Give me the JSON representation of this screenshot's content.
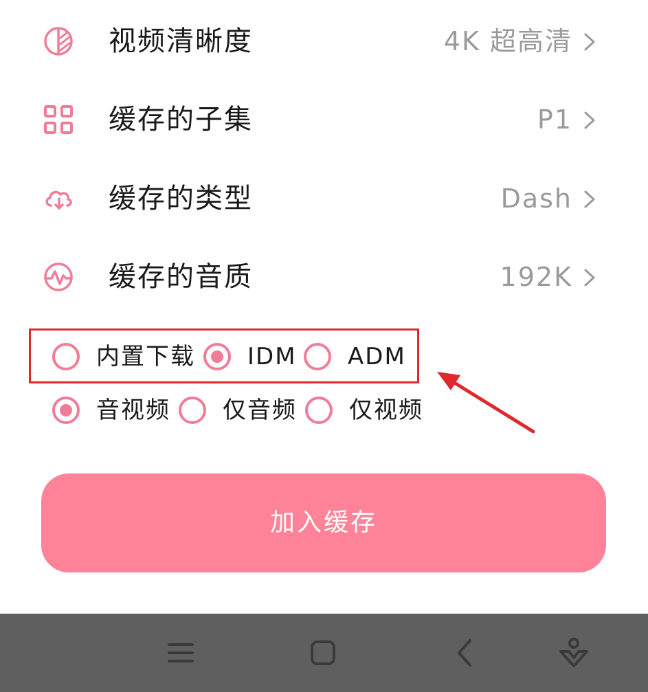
{
  "settings": [
    {
      "icon": "contrast-icon",
      "label": "视频清晰度",
      "value": "4K 超高清"
    },
    {
      "icon": "grid-icon",
      "label": "缓存的子集",
      "value": "P1"
    },
    {
      "icon": "cloud-download-icon",
      "label": "缓存的类型",
      "value": "Dash"
    },
    {
      "icon": "audio-wave-icon",
      "label": "缓存的音质",
      "value": "192K"
    }
  ],
  "downloader_options": {
    "selected": "IDM",
    "items": [
      {
        "label": "内置下载",
        "checked": false
      },
      {
        "label": "IDM",
        "checked": true
      },
      {
        "label": "ADM",
        "checked": false
      }
    ]
  },
  "media_options": {
    "selected": "音视频",
    "items": [
      {
        "label": "音视频",
        "checked": true
      },
      {
        "label": "仅音频",
        "checked": false
      },
      {
        "label": "仅视频",
        "checked": false
      }
    ]
  },
  "button": {
    "label": "加入缓存"
  },
  "colors": {
    "accent": "#f07d97",
    "button": "#fe8298",
    "annotation": "#e0292d",
    "nav_bar": "#5f5f5f"
  },
  "nav_icons": [
    "menu-icon",
    "home-icon",
    "back-icon",
    "assistant-icon"
  ]
}
